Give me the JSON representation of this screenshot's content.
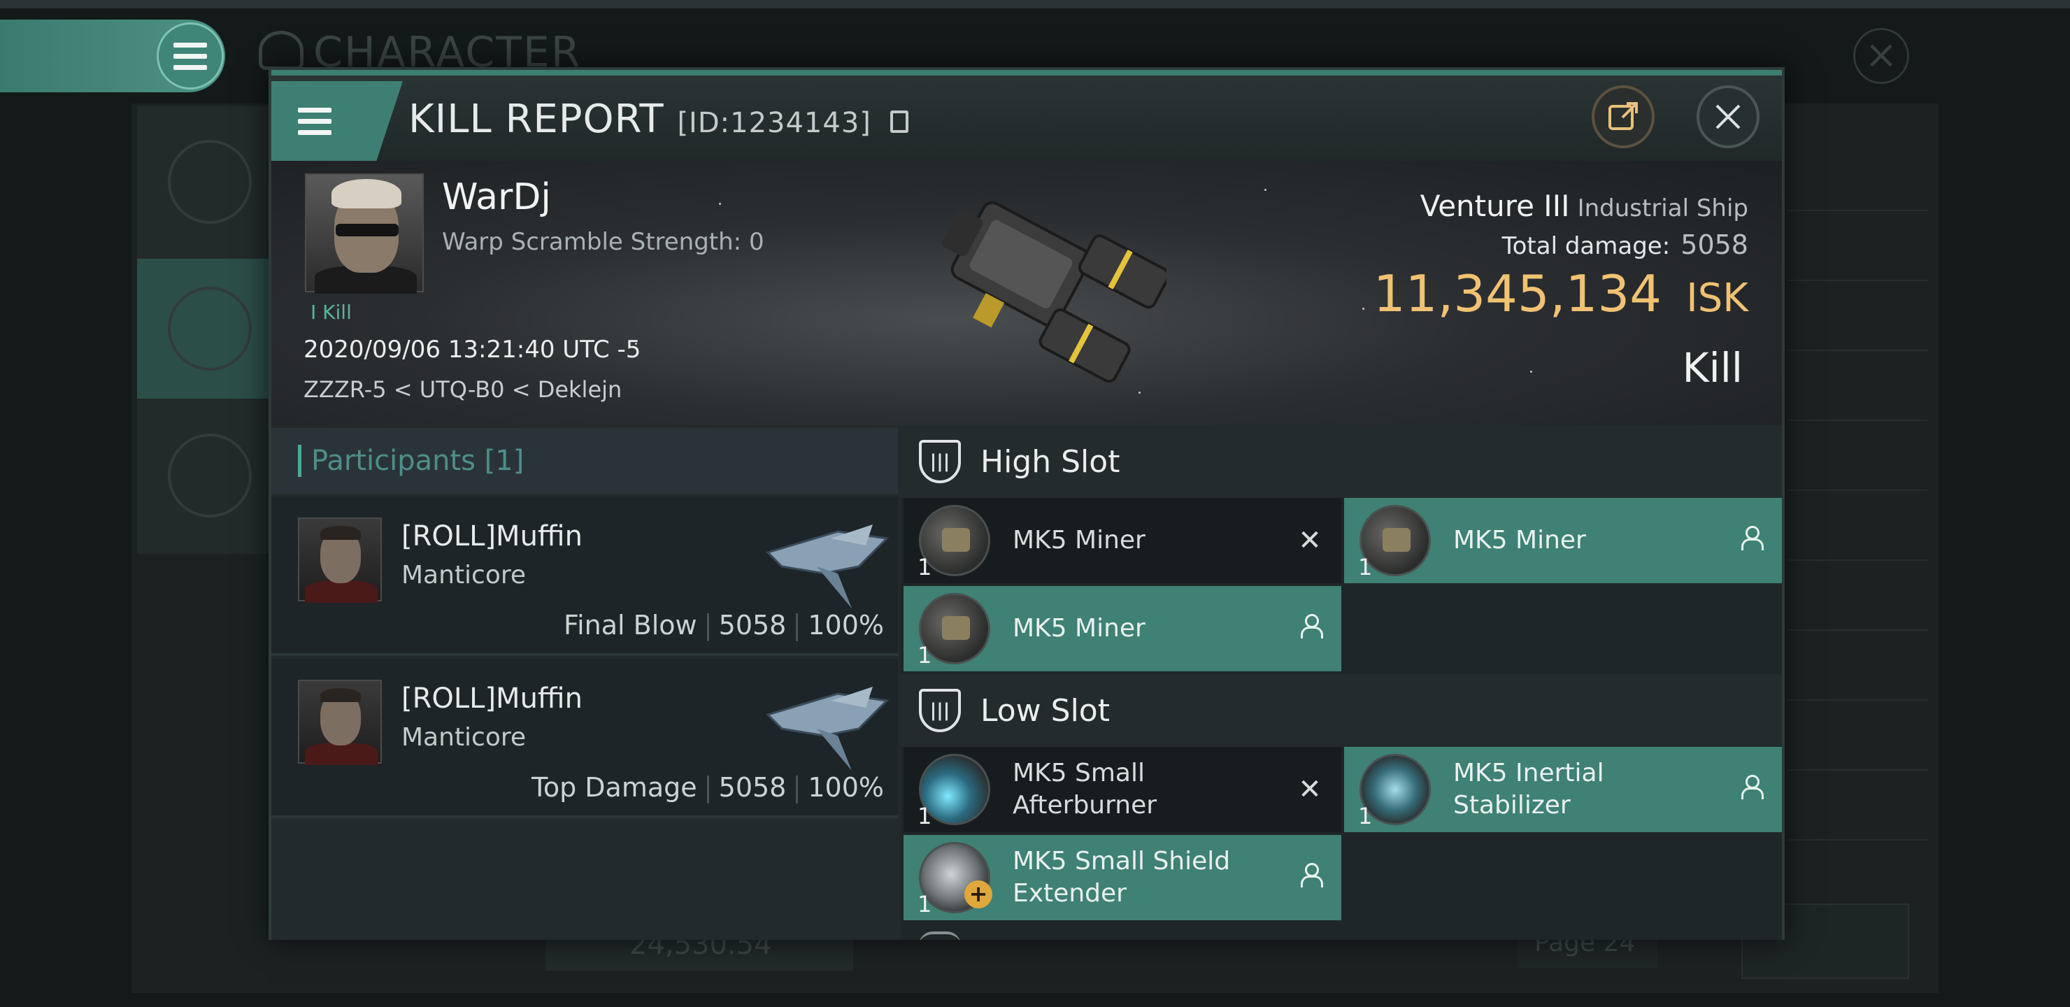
{
  "background": {
    "title": "CHARACTER",
    "isk_value": "24,530.54",
    "page_label": "Page 24"
  },
  "header": {
    "title": "KILL REPORT",
    "id_label": "[ID:1234143]"
  },
  "victim": {
    "name": "WarDj",
    "warp_scramble": "Warp Scramble Strength: 0",
    "kill_tag": "I Kill",
    "datetime": "2020/09/06 13:21:40 UTC -5",
    "location": "ZZZR-5 < UTQ-B0 < Deklejn"
  },
  "ship": {
    "name": "Venture III",
    "class": "Industrial Ship",
    "total_damage_label": "Total damage:",
    "total_damage_value": "5058",
    "isk_value": "11,345,134",
    "isk_unit": "ISK",
    "result_label": "Kill"
  },
  "participants": {
    "title": "Participants [1]",
    "items": [
      {
        "name": "[ROLL]Muffin",
        "ship": "Manticore",
        "role": "Final Blow",
        "damage": "5058",
        "percent": "100%"
      },
      {
        "name": "[ROLL]Muffin",
        "ship": "Manticore",
        "role": "Top Damage",
        "damage": "5058",
        "percent": "100%"
      }
    ]
  },
  "slots": {
    "high": {
      "label": "High Slot",
      "modules": [
        {
          "name": "MK5 Miner",
          "qty": "1",
          "status": "dropped",
          "icon": "miner-icon"
        },
        {
          "name": "MK5 Miner",
          "qty": "1",
          "status": "destroyed",
          "icon": "miner-icon"
        },
        {
          "name": "MK5 Miner",
          "qty": "1",
          "status": "destroyed",
          "icon": "miner-icon"
        }
      ]
    },
    "low": {
      "label": "Low Slot",
      "modules": [
        {
          "name": "MK5 Small Afterburner",
          "qty": "1",
          "status": "dropped",
          "icon": "afterburner-icon"
        },
        {
          "name": "MK5 Inertial Stabilizer",
          "qty": "1",
          "status": "destroyed",
          "icon": "inertial-stabilizer-icon"
        },
        {
          "name": "MK5 Small Shield Extender",
          "qty": "1",
          "status": "destroyed",
          "icon": "shield-extender-icon"
        }
      ]
    }
  },
  "colors": {
    "accent": "#3f8174",
    "isk": "#f0c272",
    "participants_title": "#4f8e88"
  }
}
